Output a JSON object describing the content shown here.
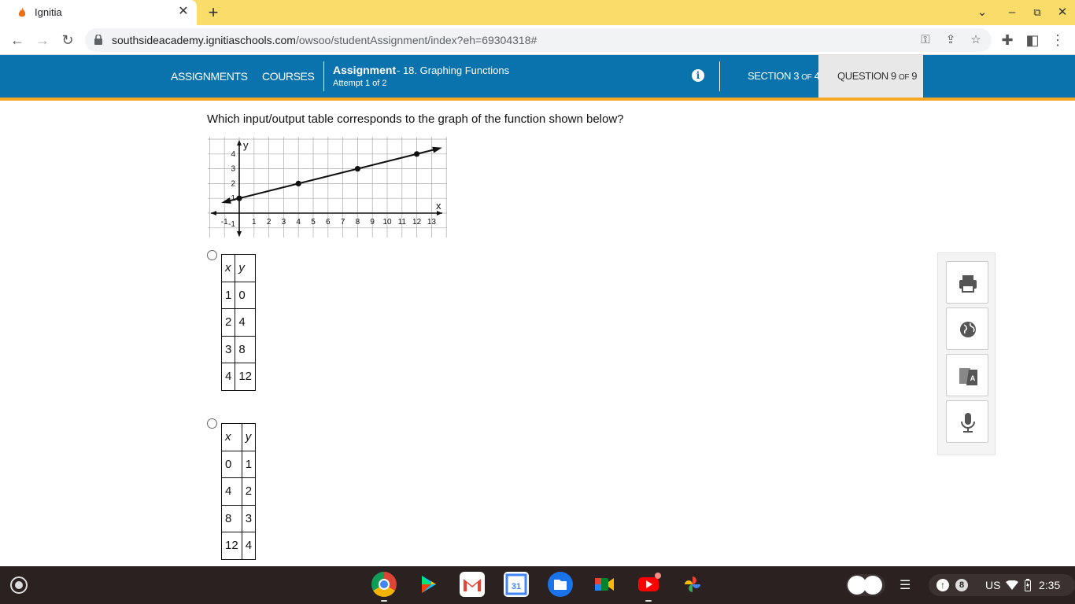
{
  "browser": {
    "tab_title": "Ignitia",
    "url_host": "southsideacademy.ignitiaschools.com",
    "url_path": "/owsoo/studentAssignment/index?eh=69304318#"
  },
  "appbar": {
    "nav_assignments": "ASSIGNMENTS",
    "nav_courses": "COURSES",
    "assignment_label": "Assignment",
    "assignment_name": "- 18. Graphing Functions",
    "attempt": "Attempt 1 of 2",
    "section_word": "SECTION",
    "section_num": "3",
    "section_of": "OF",
    "section_total": "4",
    "question_word": "QUESTION",
    "question_num": "9",
    "question_of": "OF",
    "question_total": "9"
  },
  "question": {
    "text": "Which input/output table corresponds to the graph of the function shown below?"
  },
  "graph": {
    "x_label": "x",
    "y_label": "y",
    "x_ticks": [
      "-1",
      "1",
      "2",
      "3",
      "4",
      "5",
      "6",
      "7",
      "8",
      "9",
      "10",
      "11",
      "12",
      "13"
    ],
    "y_ticks": [
      "4",
      "3",
      "2",
      "1",
      "-1"
    ],
    "points": [
      [
        0,
        1
      ],
      [
        4,
        2
      ],
      [
        8,
        3
      ],
      [
        12,
        4
      ]
    ]
  },
  "options": [
    {
      "headers": [
        "x",
        "y"
      ],
      "rows": [
        [
          "1",
          "0"
        ],
        [
          "2",
          "4"
        ],
        [
          "3",
          "8"
        ],
        [
          "4",
          "12"
        ]
      ]
    },
    {
      "headers": [
        "x",
        "y"
      ],
      "rows": [
        [
          "0",
          "1"
        ],
        [
          "4",
          "2"
        ],
        [
          "8",
          "3"
        ],
        [
          "12",
          "4"
        ]
      ]
    }
  ],
  "tools": [
    "print-icon",
    "globe-icon",
    "translate-icon",
    "microphone-icon"
  ],
  "shelf": {
    "apps": [
      "chrome",
      "play-store",
      "gmail",
      "calendar",
      "files",
      "meet",
      "youtube",
      "photos"
    ],
    "notification_count": "8",
    "locale": "US",
    "time": "2:35"
  }
}
